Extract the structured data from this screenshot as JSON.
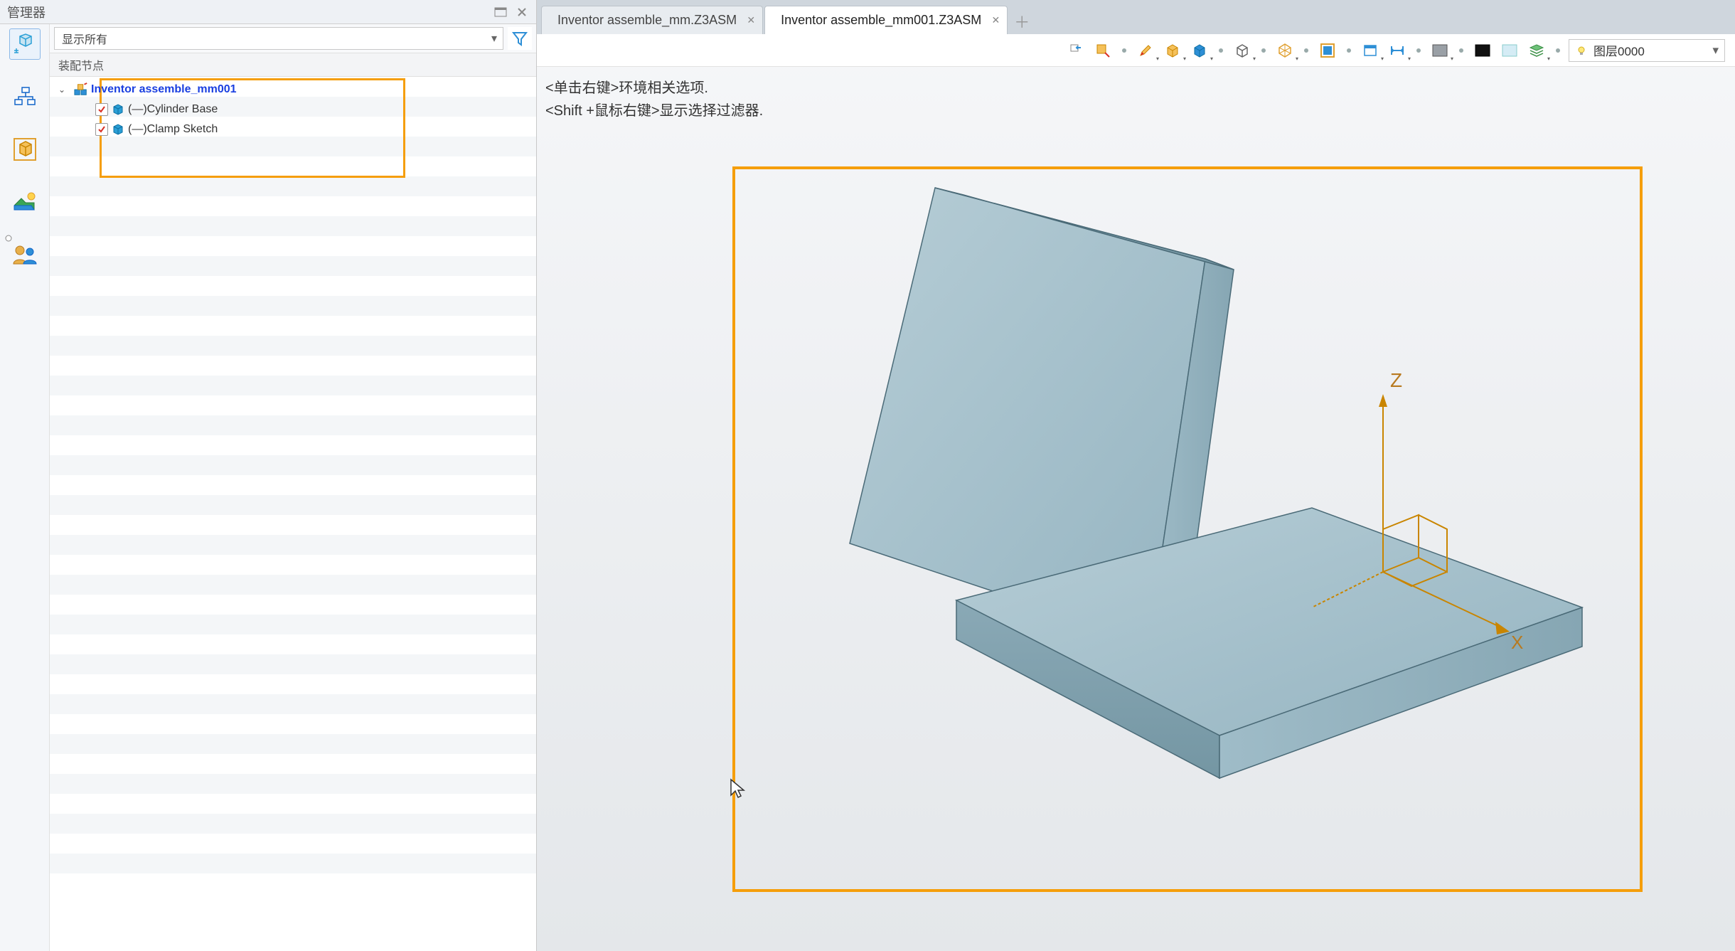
{
  "manager": {
    "title": "管理器",
    "filter_label": "显示所有",
    "column_header": "装配节点"
  },
  "tree": {
    "root": {
      "label": "Inventor assemble_mm001"
    },
    "children": [
      {
        "label": "(—)Cylinder Base",
        "checked": true
      },
      {
        "label": "(—)Clamp Sketch",
        "checked": true
      }
    ]
  },
  "tabs": [
    {
      "label": "Inventor assemble_mm.Z3ASM",
      "active": false
    },
    {
      "label": "Inventor assemble_mm001.Z3ASM",
      "active": true
    }
  ],
  "hints": {
    "line1": "<单击右键>环境相关选项.",
    "line2": "<Shift +鼠标右键>显示选择过滤器."
  },
  "layer": {
    "label": "图层0000"
  },
  "axes": {
    "z": "Z",
    "x": "X"
  }
}
